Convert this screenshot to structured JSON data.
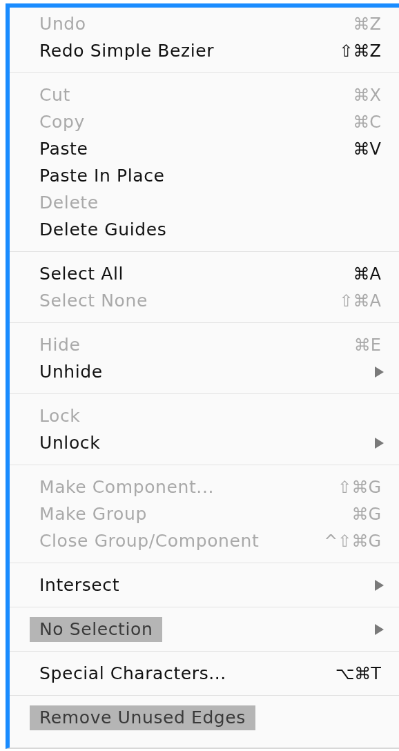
{
  "menu": {
    "groups": [
      {
        "items": [
          {
            "label": "Undo",
            "shortcut": "⌘Z",
            "disabled": true,
            "submenu": false,
            "highlighted": false
          },
          {
            "label": "Redo Simple Bezier",
            "shortcut": "⇧⌘Z",
            "disabled": false,
            "submenu": false,
            "highlighted": false
          }
        ]
      },
      {
        "items": [
          {
            "label": "Cut",
            "shortcut": "⌘X",
            "disabled": true,
            "submenu": false,
            "highlighted": false
          },
          {
            "label": "Copy",
            "shortcut": "⌘C",
            "disabled": true,
            "submenu": false,
            "highlighted": false
          },
          {
            "label": "Paste",
            "shortcut": "⌘V",
            "disabled": false,
            "submenu": false,
            "highlighted": false
          },
          {
            "label": "Paste In Place",
            "disabled": false,
            "submenu": false,
            "highlighted": false
          },
          {
            "label": "Delete",
            "disabled": true,
            "submenu": false,
            "highlighted": false
          },
          {
            "label": "Delete Guides",
            "disabled": false,
            "submenu": false,
            "highlighted": false
          }
        ]
      },
      {
        "items": [
          {
            "label": "Select All",
            "shortcut": "⌘A",
            "disabled": false,
            "submenu": false,
            "highlighted": false
          },
          {
            "label": "Select None",
            "shortcut": "⇧⌘A",
            "disabled": true,
            "submenu": false,
            "highlighted": false
          }
        ]
      },
      {
        "items": [
          {
            "label": "Hide",
            "shortcut": "⌘E",
            "disabled": true,
            "submenu": false,
            "highlighted": false
          },
          {
            "label": "Unhide",
            "disabled": false,
            "submenu": true,
            "highlighted": false
          }
        ]
      },
      {
        "items": [
          {
            "label": "Lock",
            "disabled": true,
            "submenu": false,
            "highlighted": false
          },
          {
            "label": "Unlock",
            "disabled": false,
            "submenu": true,
            "highlighted": false
          }
        ]
      },
      {
        "items": [
          {
            "label": "Make Component...",
            "shortcut": "⇧⌘G",
            "disabled": true,
            "submenu": false,
            "highlighted": false
          },
          {
            "label": "Make Group",
            "shortcut": "⌘G",
            "disabled": true,
            "submenu": false,
            "highlighted": false
          },
          {
            "label": "Close Group/Component",
            "shortcut": "^⇧⌘G",
            "disabled": true,
            "submenu": false,
            "highlighted": false
          }
        ]
      },
      {
        "items": [
          {
            "label": "Intersect",
            "disabled": false,
            "submenu": true,
            "highlighted": false
          }
        ]
      },
      {
        "items": [
          {
            "label": "No Selection",
            "disabled": false,
            "submenu": true,
            "highlighted": true
          }
        ]
      },
      {
        "items": [
          {
            "label": "Special Characters...",
            "shortcut": "⌥⌘T",
            "disabled": false,
            "submenu": false,
            "highlighted": false
          }
        ]
      },
      {
        "items": [
          {
            "label": "Remove Unused Edges",
            "disabled": false,
            "submenu": false,
            "highlighted": true
          }
        ]
      }
    ]
  }
}
